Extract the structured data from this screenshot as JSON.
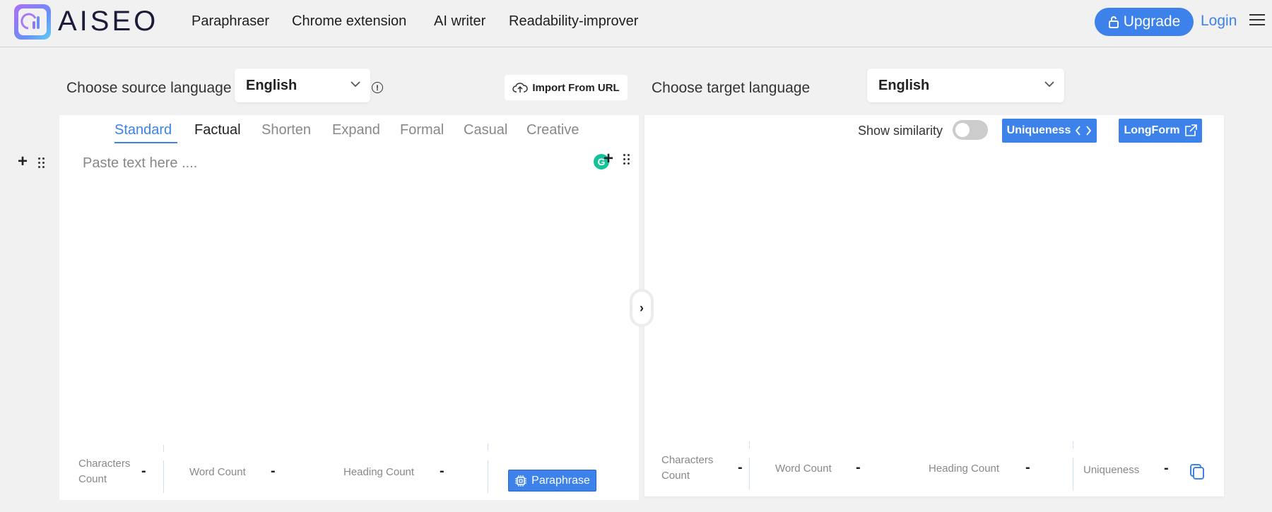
{
  "header": {
    "logo_text": "AISEO",
    "nav": [
      "Paraphraser",
      "Chrome extension",
      "AI writer",
      "Readability-improver"
    ],
    "upgrade_label": "Upgrade",
    "login_label": "Login"
  },
  "source": {
    "label": "Choose source language",
    "selected": "English",
    "import_label": "Import From URL"
  },
  "target": {
    "label": "Choose target language",
    "selected": "English"
  },
  "modes": [
    "Standard",
    "Factual",
    "Shorten",
    "Expand",
    "Formal",
    "Casual",
    "Creative"
  ],
  "active_mode": "Standard",
  "editor": {
    "placeholder": "Paste text here ....",
    "grammarly_badge": "G"
  },
  "right_toolbar": {
    "similarity_label": "Show similarity",
    "similarity_on": false,
    "uniqueness_label": "Uniqueness",
    "longform_label": "LongForm"
  },
  "left_stats": {
    "characters_label_1": "Characters",
    "characters_label_2": "Count",
    "characters_value": "-",
    "word_label": "Word Count",
    "word_value": "-",
    "heading_label": "Heading Count",
    "heading_value": "-",
    "paraphrase_label": "Paraphrase"
  },
  "right_stats": {
    "characters_label_1": "Characters",
    "characters_label_2": "Count",
    "characters_value": "-",
    "word_label": "Word Count",
    "word_value": "-",
    "heading_label": "Heading Count",
    "heading_value": "-",
    "uniqueness_label": "Uniqueness",
    "uniqueness_value": "-"
  },
  "colors": {
    "accent": "#3d82ea",
    "background": "#f1f1f1",
    "grammarly": "#15c39a"
  },
  "icons": [
    "logo-icon",
    "lock-icon",
    "menu-icon",
    "chevron-down-icon",
    "info-icon",
    "cloud-upload-icon",
    "plus-icon",
    "drag-handle-icon",
    "chevron-right-icon",
    "code-icon",
    "external-link-icon",
    "chip-icon",
    "copy-icon"
  ]
}
